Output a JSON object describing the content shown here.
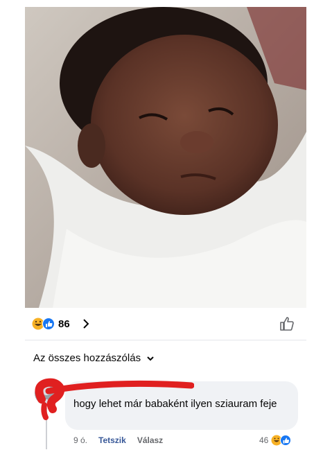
{
  "post": {
    "reactions": {
      "count": "86",
      "icons": [
        "haha-icon",
        "like-icon"
      ]
    },
    "all_comments_label": "Az összes hozzászólás"
  },
  "comment": {
    "text": "hogy lehet már babaként ilyen sziauram feje",
    "time": "9 ó.",
    "like_label": "Tetszik",
    "reply_label": "Válasz",
    "reaction_count": "46",
    "reaction_icons": [
      "haha-icon",
      "like-icon"
    ]
  },
  "colors": {
    "facebook_blue": "#1877f2",
    "haha_yellow": "#f7b125",
    "bubble_gray": "#f0f2f5",
    "redaction_red": "#e02020"
  }
}
